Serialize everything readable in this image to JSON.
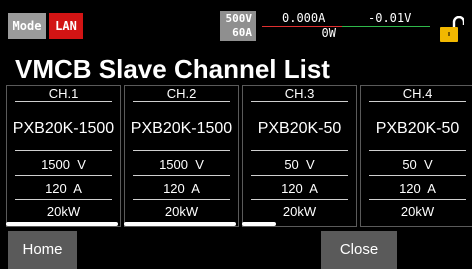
{
  "status": {
    "mode_label": "Mode",
    "interface_label": "LAN",
    "voltage_limit": "500V",
    "current_limit": "60A",
    "current_reading": "0.000A",
    "voltage_reading": "-0.01V",
    "power_reading": "0W",
    "lock_icon": "padlock-unlocked-icon",
    "colors": {
      "interface": "#d21414",
      "current_line": "#e03030",
      "voltage_line": "#2fb84a",
      "lock": "#f2b800"
    }
  },
  "page": {
    "title": "VMCB Slave Channel List"
  },
  "channels": [
    {
      "name": "CH.1",
      "model": "PXB20K-1500",
      "voltage": "1500  V",
      "current": "120  A",
      "power": "20kW"
    },
    {
      "name": "CH.2",
      "model": "PXB20K-1500",
      "voltage": "1500  V",
      "current": "120  A",
      "power": "20kW"
    },
    {
      "name": "CH.3",
      "model": "PXB20K-50",
      "voltage": "50  V",
      "current": "120  A",
      "power": "20kW"
    },
    {
      "name": "CH.4",
      "model": "PXB20K-50",
      "voltage": "50  V",
      "current": "120  A",
      "power": "20kW"
    }
  ],
  "buttons": {
    "home": "Home",
    "close": "Close"
  }
}
